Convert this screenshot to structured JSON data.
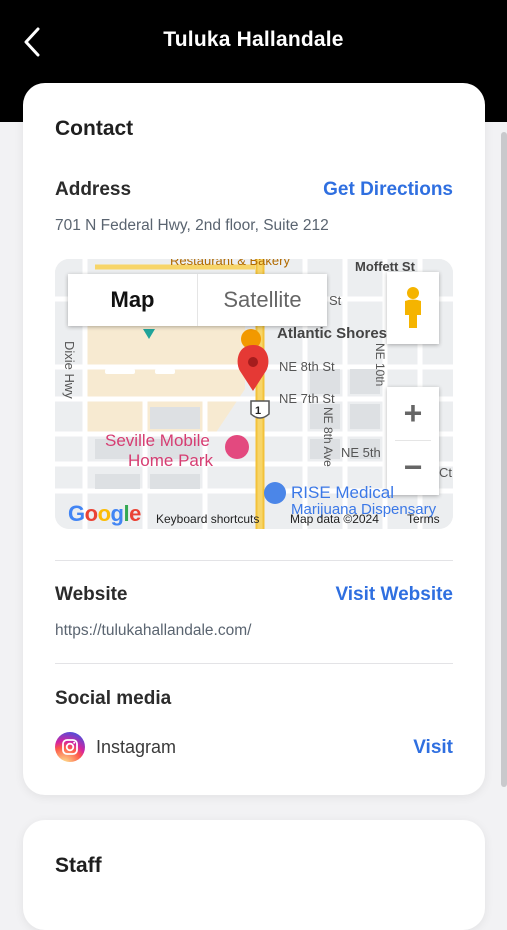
{
  "header": {
    "title": "Tuluka Hallandale"
  },
  "contact": {
    "section_title": "Contact",
    "address_label": "Address",
    "directions_link": "Get Directions",
    "address_value": "701 N Federal Hwy, 2nd floor, Suite 212",
    "website_label": "Website",
    "website_link": "Visit Website",
    "website_value": "https://tulukahallandale.com/",
    "social_label": "Social media",
    "social_items": [
      {
        "name": "Instagram",
        "link": "Visit"
      }
    ]
  },
  "map": {
    "type_options": [
      "Map",
      "Satellite"
    ],
    "active_type": "Map",
    "zoom_in": "+",
    "zoom_out": "−",
    "labels": {
      "restaurant": "Restaurant & Bakery",
      "moffett": "Moffett St",
      "atlantic": "Atlantic Shores",
      "ne8": "NE 8th St",
      "ne7": "NE 7th St",
      "ne5": "NE 5th",
      "ne10": "NE 10th",
      "ne8ave": "NE 8th Ave",
      "dixie": "Dixie Hwy",
      "seville1": "Seville Mobile",
      "seville2": "Home Park",
      "rise1": "RISE Medical",
      "rise2": "Marijuana Dispensary",
      "route": "1",
      "st": "St",
      "ct": "Ct"
    },
    "footer": {
      "google": "Google",
      "shortcuts": "Keyboard shortcuts",
      "mapdata": "Map data ©2024",
      "terms": "Terms"
    }
  },
  "staff": {
    "section_title": "Staff"
  },
  "colors": {
    "link": "#2f6fe0",
    "header_bg": "#000000",
    "pin": "#e53935"
  }
}
